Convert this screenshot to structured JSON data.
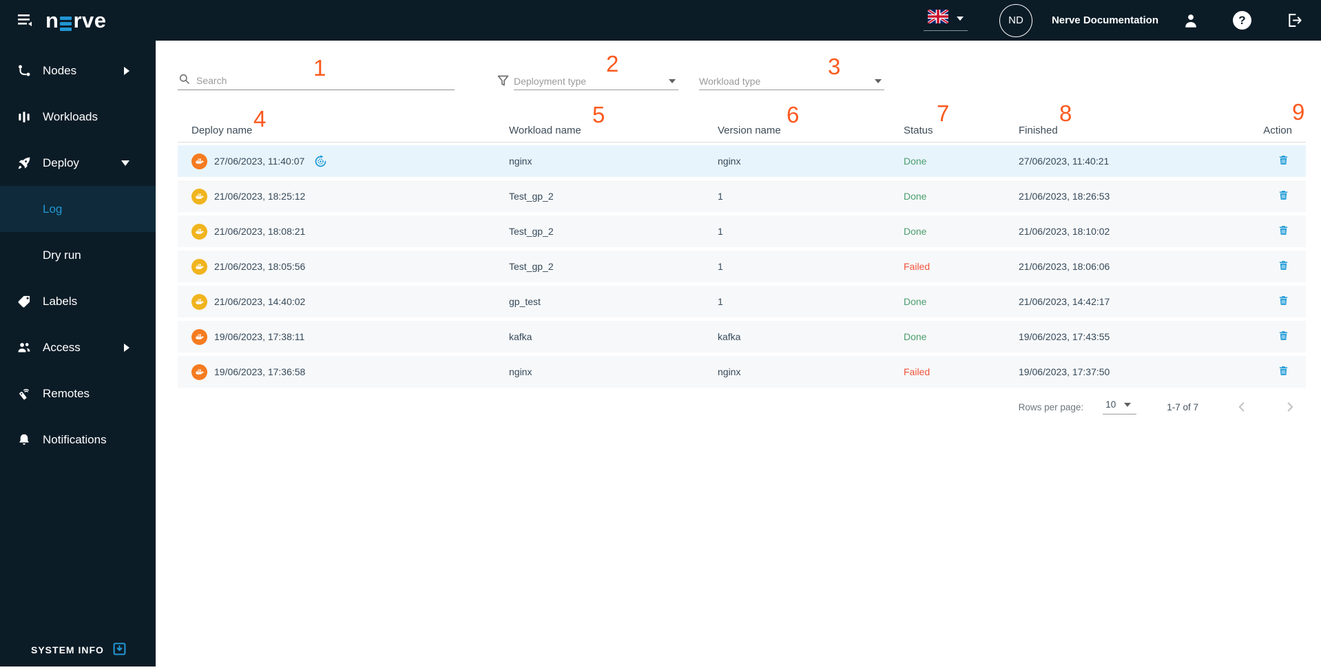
{
  "topbar": {
    "logo_text": "nerve",
    "avatar_initials": "ND",
    "docs_label": "Nerve Documentation",
    "icons": [
      "menu-collapse-icon",
      "uk-flag-icon",
      "user-icon",
      "help-icon",
      "logout-icon"
    ],
    "help_glyph": "?"
  },
  "sidebar": {
    "items": [
      {
        "label": "Nodes",
        "icon": "nodes-icon",
        "chevron": "right"
      },
      {
        "label": "Workloads",
        "icon": "workloads-icon"
      },
      {
        "label": "Deploy",
        "icon": "deploy-rocket-icon",
        "chevron": "down",
        "expanded": true
      },
      {
        "label": "Log",
        "sub": true,
        "active": true
      },
      {
        "label": "Dry run",
        "sub": true
      },
      {
        "label": "Labels",
        "icon": "label-tag-icon"
      },
      {
        "label": "Access",
        "icon": "access-people-icon",
        "chevron": "right"
      },
      {
        "label": "Remotes",
        "icon": "remote-control-icon"
      },
      {
        "label": "Notifications",
        "icon": "bell-icon"
      }
    ],
    "system_info_label": "SYSTEM INFO",
    "system_info_icon": "download-box-icon"
  },
  "filters": {
    "search_placeholder": "Search",
    "filter_icon": "funnel-icon",
    "deployment_type_placeholder": "Deployment type",
    "workload_type_placeholder": "Workload type"
  },
  "table": {
    "columns": [
      "Deploy name",
      "Workload name",
      "Version name",
      "Status",
      "Finished",
      "Action"
    ],
    "rows": [
      {
        "icon": "docker-whale-icon",
        "icon_color": "orange",
        "deploy_name": "27/06/2023, 11:40:07",
        "redeploy": true,
        "workload_name": "nginx",
        "version_name": "nginx",
        "status": "Done",
        "finished": "27/06/2023, 11:40:21",
        "action_icon": "trash-icon",
        "highlighted": true
      },
      {
        "icon": "docker-whale-icon",
        "icon_color": "yellow",
        "deploy_name": "21/06/2023, 18:25:12",
        "redeploy": false,
        "workload_name": "Test_gp_2",
        "version_name": "1",
        "status": "Done",
        "finished": "21/06/2023, 18:26:53",
        "action_icon": "trash-icon",
        "highlighted": false
      },
      {
        "icon": "docker-whale-icon",
        "icon_color": "yellow",
        "deploy_name": "21/06/2023, 18:08:21",
        "redeploy": false,
        "workload_name": "Test_gp_2",
        "version_name": "1",
        "status": "Done",
        "finished": "21/06/2023, 18:10:02",
        "action_icon": "trash-icon",
        "highlighted": false
      },
      {
        "icon": "docker-whale-icon",
        "icon_color": "yellow",
        "deploy_name": "21/06/2023, 18:05:56",
        "redeploy": false,
        "workload_name": "Test_gp_2",
        "version_name": "1",
        "status": "Failed",
        "finished": "21/06/2023, 18:06:06",
        "action_icon": "trash-icon",
        "highlighted": false
      },
      {
        "icon": "docker-whale-icon",
        "icon_color": "yellow",
        "deploy_name": "21/06/2023, 14:40:02",
        "redeploy": false,
        "workload_name": "gp_test",
        "version_name": "1",
        "status": "Done",
        "finished": "21/06/2023, 14:42:17",
        "action_icon": "trash-icon",
        "highlighted": false
      },
      {
        "icon": "docker-whale-icon",
        "icon_color": "orange",
        "deploy_name": "19/06/2023, 17:38:11",
        "redeploy": false,
        "workload_name": "kafka",
        "version_name": "kafka",
        "status": "Done",
        "finished": "19/06/2023, 17:43:55",
        "action_icon": "trash-icon",
        "highlighted": false
      },
      {
        "icon": "docker-whale-icon",
        "icon_color": "orange",
        "deploy_name": "19/06/2023, 17:36:58",
        "redeploy": false,
        "workload_name": "nginx",
        "version_name": "nginx",
        "status": "Failed",
        "finished": "19/06/2023, 17:37:50",
        "action_icon": "trash-icon",
        "highlighted": false
      }
    ]
  },
  "pagination": {
    "rows_per_page_label": "Rows per page:",
    "rows_per_page_value": "10",
    "range_label": "1-7 of 7",
    "prev_icon": "chevron-left-icon",
    "next_icon": "chevron-right-icon"
  },
  "annotations": [
    "1",
    "2",
    "3",
    "4",
    "5",
    "6",
    "7",
    "8",
    "9"
  ],
  "colors": {
    "accent_blue": "#2196d3",
    "status_done": "#4a9e6e",
    "status_failed": "#f4543d",
    "row_icon_orange": "#f57b20",
    "row_icon_yellow": "#f0b41e",
    "annotation_orange": "#fb5a1f",
    "topbar_bg": "#0b1c27",
    "sidebar_bg": "#0c1c27",
    "selected_row_bg": "#e8f4fc"
  }
}
